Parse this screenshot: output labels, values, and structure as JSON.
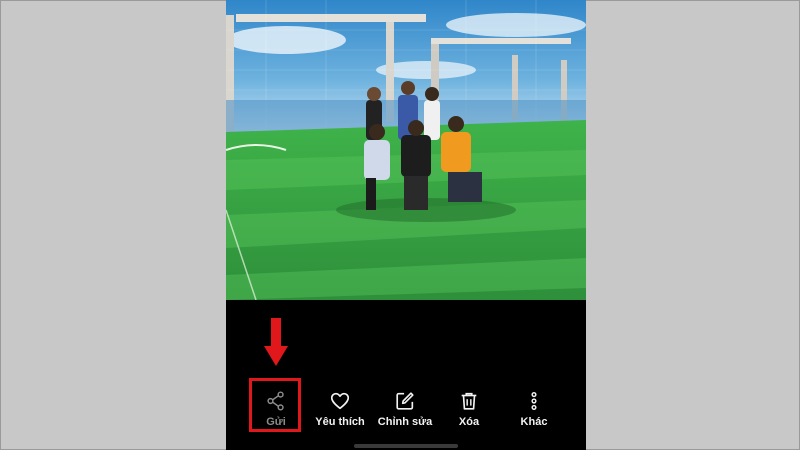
{
  "colors": {
    "background": "#c8c8c8",
    "phone_background": "#000000",
    "toolbar_text": "#f2f2f2",
    "disabled_text": "#8c8c8c",
    "highlight": "#e0171b"
  },
  "photo": {
    "subject": "group photo on rooftop soccer field"
  },
  "toolbar": {
    "items": [
      {
        "label": "Gửi",
        "icon": "share-icon"
      },
      {
        "label": "Yêu thích",
        "icon": "heart-icon"
      },
      {
        "label": "Chỉnh sửa",
        "icon": "edit-icon"
      },
      {
        "label": "Xóa",
        "icon": "trash-icon"
      },
      {
        "label": "Khác",
        "icon": "more-vertical-icon"
      }
    ]
  },
  "annotation": {
    "highlighted_item": "Gửi",
    "arrow_direction": "down"
  }
}
